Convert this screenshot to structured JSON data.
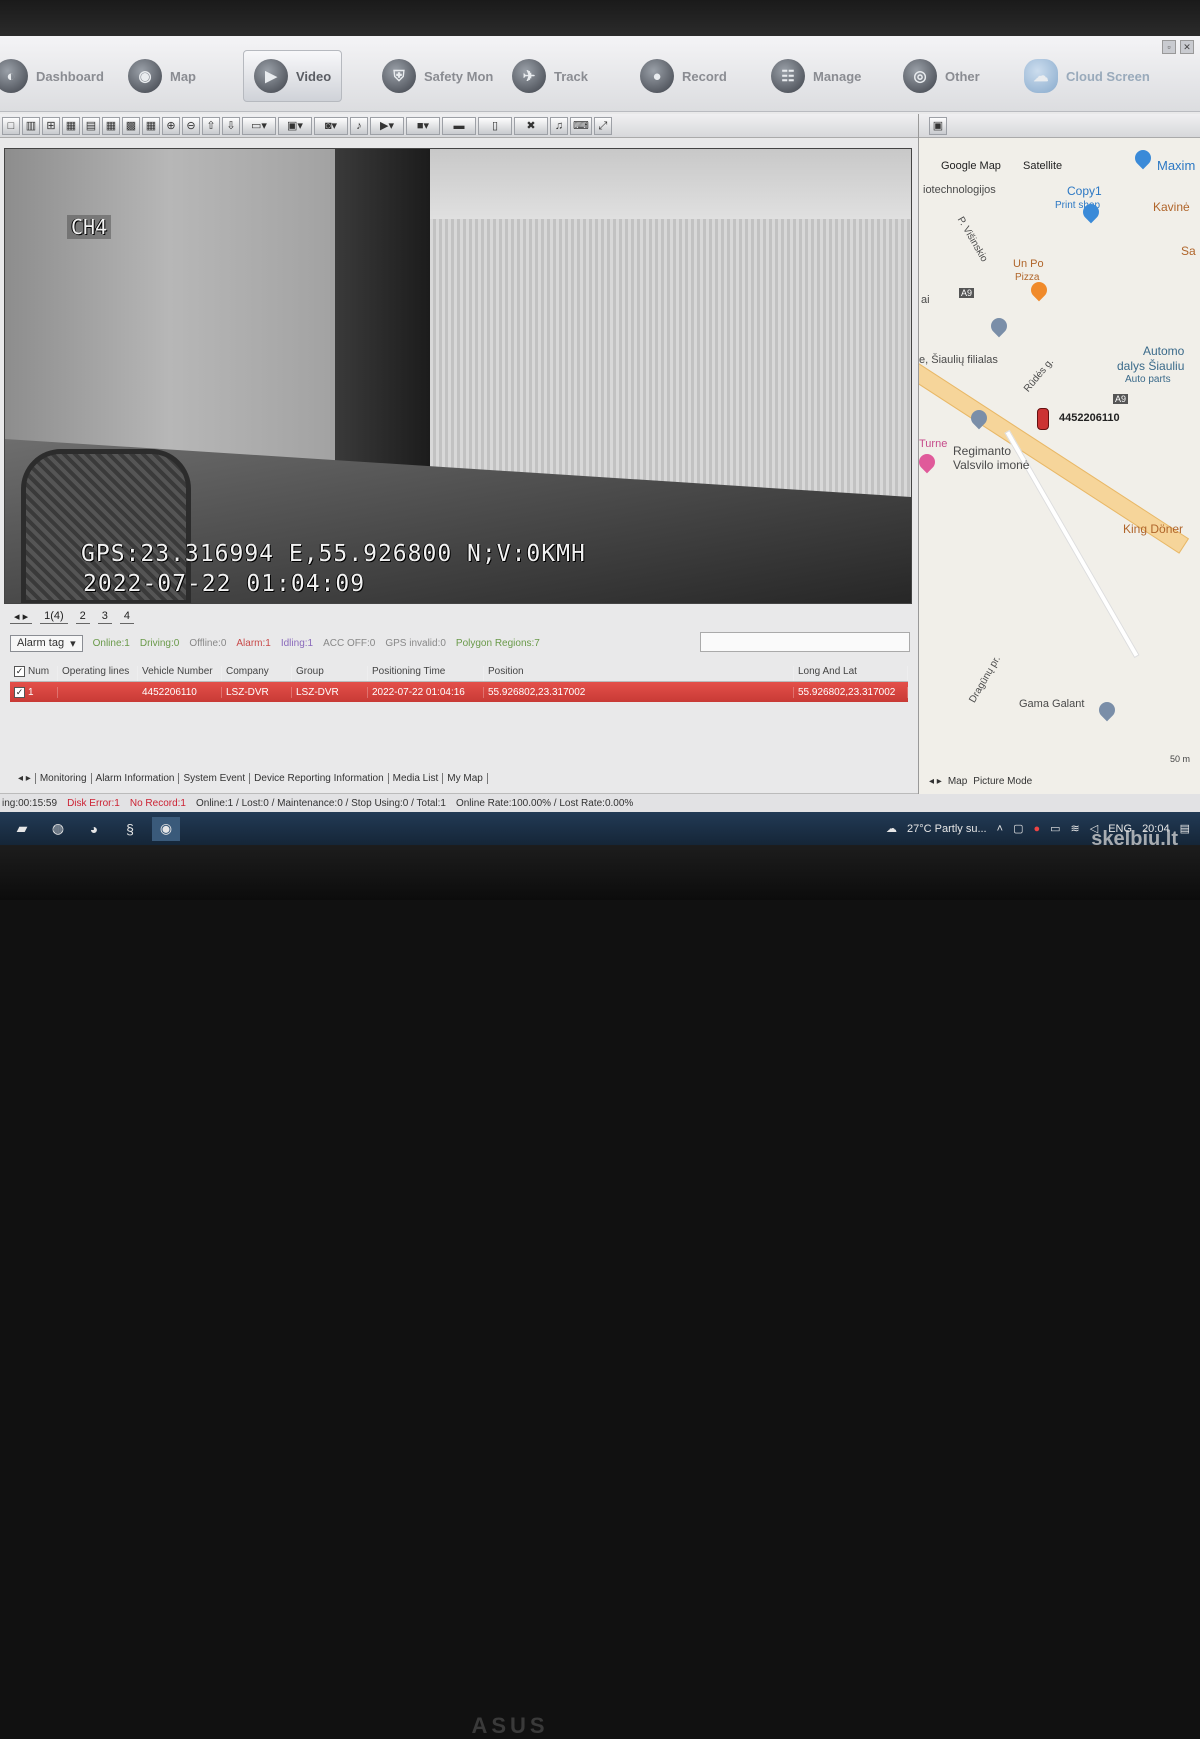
{
  "nav": {
    "items": [
      {
        "label": "Dashboard",
        "icon": "dashboard-icon"
      },
      {
        "label": "Map",
        "icon": "map-icon"
      },
      {
        "label": "Video",
        "icon": "video-icon"
      },
      {
        "label": "Safety Mon",
        "icon": "shield-icon"
      },
      {
        "label": "Track",
        "icon": "track-icon"
      },
      {
        "label": "Record",
        "icon": "record-icon"
      },
      {
        "label": "Manage",
        "icon": "manage-icon"
      },
      {
        "label": "Other",
        "icon": "other-icon"
      }
    ],
    "cloud_label": "Cloud Screen"
  },
  "video": {
    "channel": "CH4",
    "gps_text": "GPS:23.316994 E,55.926800 N;V:0KMH",
    "datetime_text": "2022-07-22 01:04:09"
  },
  "channel_tabs": [
    "1(4)",
    "2",
    "3",
    "4"
  ],
  "status": {
    "alarm_tag": "Alarm tag",
    "online": "Online:1",
    "driving": "Driving:0",
    "offline": "Offline:0",
    "alarm": "Alarm:1",
    "idling": "Idling:1",
    "acc_off": "ACC OFF:0",
    "gps_invalid": "GPS invalid:0",
    "polygon": "Polygon Regions:7"
  },
  "table": {
    "headers": [
      "Num",
      "Operating lines",
      "Vehicle Number",
      "Company",
      "Group",
      "Positioning Time",
      "Position",
      "Long And Lat"
    ],
    "rows": [
      {
        "num": "1",
        "operating": "",
        "vehicle": "4452206110",
        "company": "LSZ-DVR",
        "group": "LSZ-DVR",
        "time": "2022-07-22 01:04:16",
        "position": "55.926802,23.317002",
        "longlat": "55.926802,23.317002"
      }
    ]
  },
  "bottom_tabs": [
    "Monitoring",
    "Alarm Information",
    "System Event",
    "Device Reporting Information",
    "Media List",
    "My Map"
  ],
  "infobar": {
    "time": "ing:00:15:59",
    "disk_error": "Disk Error:1",
    "no_record": "No Record:1",
    "rest": "Online:1 / Lost:0 / Maintenance:0 / Stop Using:0 / Total:1",
    "rates": "Online Rate:100.00% / Lost Rate:0.00%"
  },
  "map": {
    "type_map": "Google Map",
    "type_satellite": "Satellite",
    "labels": {
      "biotech": "iotechnologijos",
      "copy1": "Copy1",
      "print_shop": "Print shop",
      "maxima": "Maxim",
      "kavine": "Kavinė",
      "sa": "Sa",
      "visinskio": "P. Višinskio",
      "unpo": "Un Po",
      "pizza": "Pizza",
      "a9_1": "A9",
      "a9_2": "A9",
      "ai": "ai",
      "siauliu": "e, Šiaulių filialas",
      "rudes": "Rūdės g.",
      "automob": "Automo",
      "dalys": "dalys Šiauliu",
      "autoparts": "Auto parts",
      "regimanto": "Regimanto",
      "valsvilo": "Valsvilo imonė",
      "turne": "Turne",
      "king": "King Döner",
      "dragunu": "Dragūnų pr.",
      "gama": "Gama Galant",
      "scale": "50 m"
    },
    "vehicle": "4452206110",
    "tabs": [
      "Map",
      "Picture Mode"
    ]
  },
  "taskbar": {
    "weather": "27°C  Partly su...",
    "lang": "ENG",
    "clock": "20:04"
  },
  "watermark": "skelbiu.lt"
}
